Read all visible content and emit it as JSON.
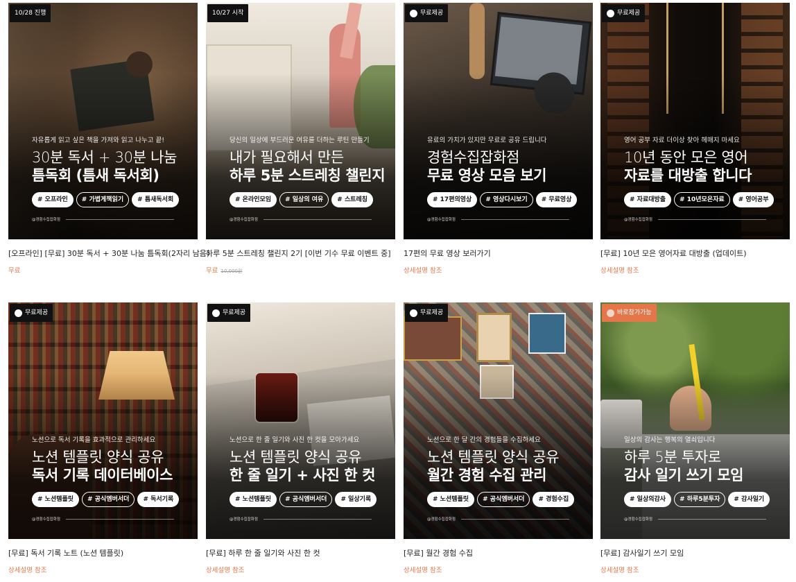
{
  "cards": [
    {
      "badge": "10/28 진행",
      "badge_style": "dark",
      "subtitle": "자유롭게 읽고 싶은 책을 가져와 읽고 나누고 끝!",
      "line1": "30분 독서 + 30분 나눔",
      "line2": "틈독회 (틈새 독서회)",
      "tags": [
        "# 오프라인",
        "# 가볍게책읽기",
        "# 틈새독서회"
      ],
      "footer": "@경험수집잡화점",
      "title": "[오프라인] [무료] 30분 독서 + 30분 나눔 틈독회(2자리 남음)",
      "price": "무료",
      "old_price": ""
    },
    {
      "badge": "10/27 시작",
      "badge_style": "dark",
      "subtitle": "당신의 일상에 부드러운 여유를 더하는 루틴 만들기",
      "line1": "내가 필요해서 만든",
      "line2": "하루 5분 스트레칭 챌린지",
      "tags": [
        "# 온라인모임",
        "# 일상의 여유",
        "# 스트레칭"
      ],
      "footer": "@경험수집잡화점",
      "title": "하루 5분 스트레칭 챌린지 2기 [이번 기수 무료 이벤트 중]",
      "price": "무료",
      "old_price": "10,000원"
    },
    {
      "badge": "무료제공",
      "badge_style": "dark-dot",
      "subtitle": "유료의 가치가 있지만 무료로 공유 드립니다",
      "line1": "경험수집잡화점",
      "line2": "무료 영상 모음 보기",
      "tags": [
        "# 17편의영상",
        "# 영상다시보기",
        "# 무료영상"
      ],
      "footer": "@경험수집잡화점",
      "title": "17편의 무료 영상 보러가기",
      "price": "상세설명 참조",
      "old_price": ""
    },
    {
      "badge": "무료제공",
      "badge_style": "dark-dot",
      "subtitle": "영어 공부 자료 더이상 찾아 헤매지 마세요",
      "line1": "10년 동안 모은 영어",
      "line2": "자료를 대방출 합니다",
      "tags": [
        "# 자료대방출",
        "# 10년모은자료",
        "# 영어공부"
      ],
      "footer": "@경험수집잡화점",
      "title": "[무료] 10년 모은 영어자료 대방출 (업데이트)",
      "price": "상세설명 참조",
      "old_price": ""
    },
    {
      "badge": "무료제공",
      "badge_style": "dark-dot",
      "subtitle": "노션으로 독서 기록을 효과적으로 관리하세요",
      "line1": "노션 템플릿 양식 공유",
      "line2": "독서 기록 데이터베이스",
      "tags": [
        "# 노션템플릿",
        "# 공식엠버서더",
        "# 독서기록"
      ],
      "footer": "@경험수집잡화점",
      "title": "[무료] 독서 기록 노트 (노션 템플릿)",
      "price": "상세설명 참조",
      "old_price": ""
    },
    {
      "badge": "무료제공",
      "badge_style": "dark-dot",
      "subtitle": "노션으로 한 줄 일기와 사진 한 컷을 모아가세요",
      "line1": "노션 템플릿 양식 공유",
      "line2": "한 줄 일기 + 사진 한 컷",
      "tags": [
        "# 노션템플릿",
        "# 공식엠버서더",
        "# 일상기록"
      ],
      "footer": "@경험수집잡화점",
      "title": "[무료] 하루 한 줄 일기와 사진 한 컷",
      "price": "상세설명 참조",
      "old_price": ""
    },
    {
      "badge": "무료제공",
      "badge_style": "dark-dot",
      "subtitle": "노션으로 한 달 간의 경험들을 수집하세요",
      "line1": "노션 템플릿 양식 공유",
      "line2": "월간 경험 수집 관리",
      "tags": [
        "# 노션템플릿",
        "# 공식엠버서더",
        "# 경험수집"
      ],
      "footer": "@경험수집잡화점",
      "title": "[무료] 월간 경험 수집",
      "price": "상세설명 참조",
      "old_price": ""
    },
    {
      "badge": "바로참가가능",
      "badge_style": "orange-dot",
      "subtitle": "일상의 감사는 행복의 열쇠입니다",
      "line1": "하루 5분 투자로",
      "line2": "감사 일기 쓰기 모임",
      "tags": [
        "# 일상의감사",
        "# 하루5분투자",
        "# 감사일기"
      ],
      "footer": "@경험수집잡화점",
      "title": "[무료] 감사일기 쓰기 모임",
      "price": "상세설명 참조",
      "old_price": ""
    }
  ]
}
